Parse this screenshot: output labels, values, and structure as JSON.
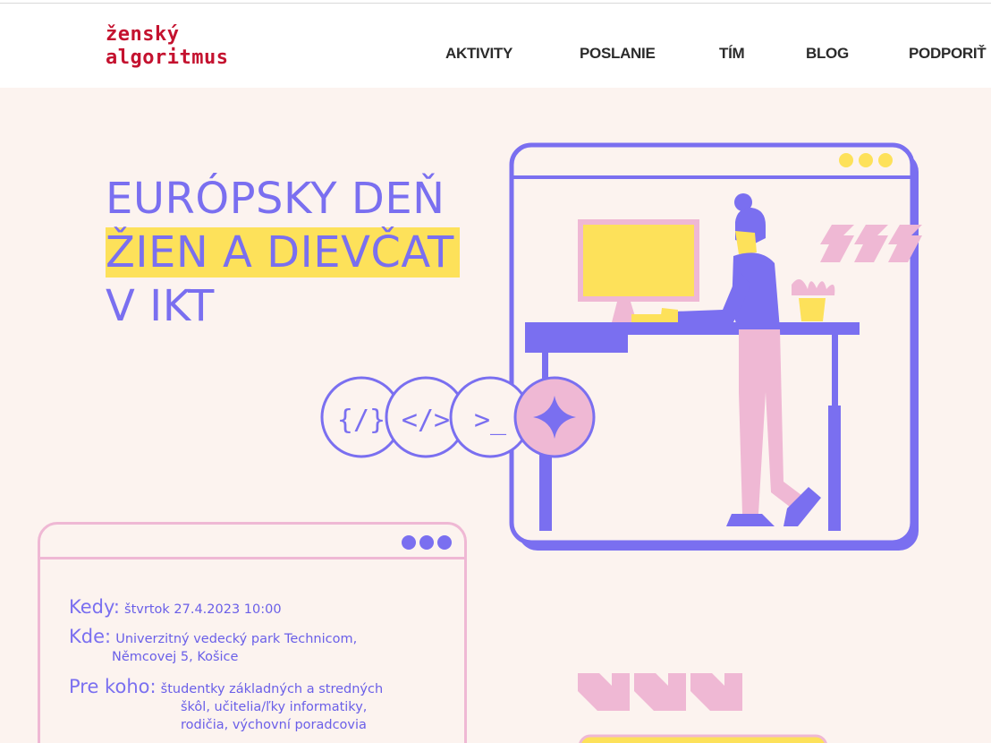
{
  "brand": {
    "line1": "ženský",
    "line2": "algoritmus",
    "color": "#c4122f"
  },
  "nav": {
    "items": [
      {
        "label": "AKTIVITY"
      },
      {
        "label": "POSLANIE"
      },
      {
        "label": "TÍM"
      },
      {
        "label": "BLOG"
      },
      {
        "label": "PODPORIŤ"
      }
    ]
  },
  "hero": {
    "title_line1": "EURÓPSKY DEŇ",
    "title_line2": "ŽIEN A DIEVČAT",
    "title_line3": "V IKT",
    "accent": "#7a6ff0",
    "highlight": "#fde15a",
    "pink": "#efb8d4"
  },
  "code_icons": {
    "braces": "{/}",
    "tag": "</>",
    "prompt": ">_",
    "star_icon": "sparkle-icon"
  },
  "event": {
    "when_label": "Kedy:",
    "when_value": "štvrtok 27.4.2023 10:00",
    "where_label": "Kde:",
    "where_value_1": "Univerzitný vedecký park Technicom,",
    "where_value_2": "Němcovej 5, Košice",
    "who_label": "Pre koho:",
    "who_value_1": "študentky základných a stredných",
    "who_value_2": "škôl, učitelia/ľky informatiky,",
    "who_value_3": "rodičia, výchovní poradcovia"
  }
}
